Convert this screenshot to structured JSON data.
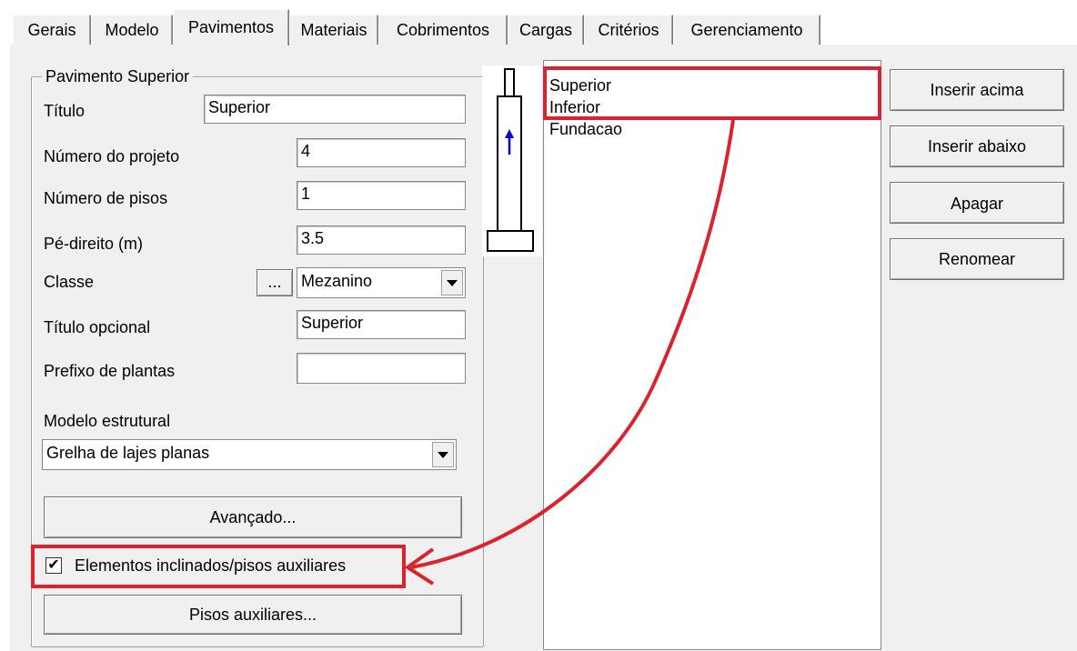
{
  "tabs": [
    "Gerais",
    "Modelo",
    "Pavimentos",
    "Materiais",
    "Cobrimentos",
    "Cargas",
    "Critérios",
    "Gerenciamento"
  ],
  "active_tab": "Pavimentos",
  "group": {
    "title": "Pavimento Superior",
    "fields": {
      "titulo": {
        "label": "Título",
        "value": "Superior"
      },
      "numero_projeto": {
        "label": "Número do projeto",
        "value": "4"
      },
      "numero_pisos": {
        "label": "Número de pisos",
        "value": "1"
      },
      "pe_direito": {
        "label": "Pé-direito (m)",
        "value": "3.5"
      },
      "classe": {
        "label": "Classe",
        "browse_label": "...",
        "value": "Mezanino"
      },
      "titulo_opcional": {
        "label": "Título opcional",
        "value": "Superior"
      },
      "prefixo_plantas": {
        "label": "Prefixo de plantas",
        "value": ""
      }
    },
    "modelo_estrutural": {
      "label": "Modelo estrutural",
      "value": "Grelha de lajes planas"
    },
    "avancado_button": "Avançado...",
    "checkbox": {
      "label": "Elementos inclinados/pisos auxiliares",
      "checked": true,
      "mark": "✔"
    },
    "pisos_auxiliares_button": "Pisos auxiliares..."
  },
  "floors_list": [
    "Superior",
    "Inferior",
    "Fundacao"
  ],
  "buttons": {
    "inserir_acima": "Inserir acima",
    "inserir_abaixo": "Inserir abaixo",
    "apagar": "Apagar",
    "renomear": "Renomear"
  },
  "colors": {
    "annotation_red": "#d9232e",
    "arrow_blue": "#0000cc",
    "panel": "#f0f0f0"
  },
  "icons": {
    "building": "building-column-icon",
    "up_arrow": "up-arrow-icon"
  }
}
